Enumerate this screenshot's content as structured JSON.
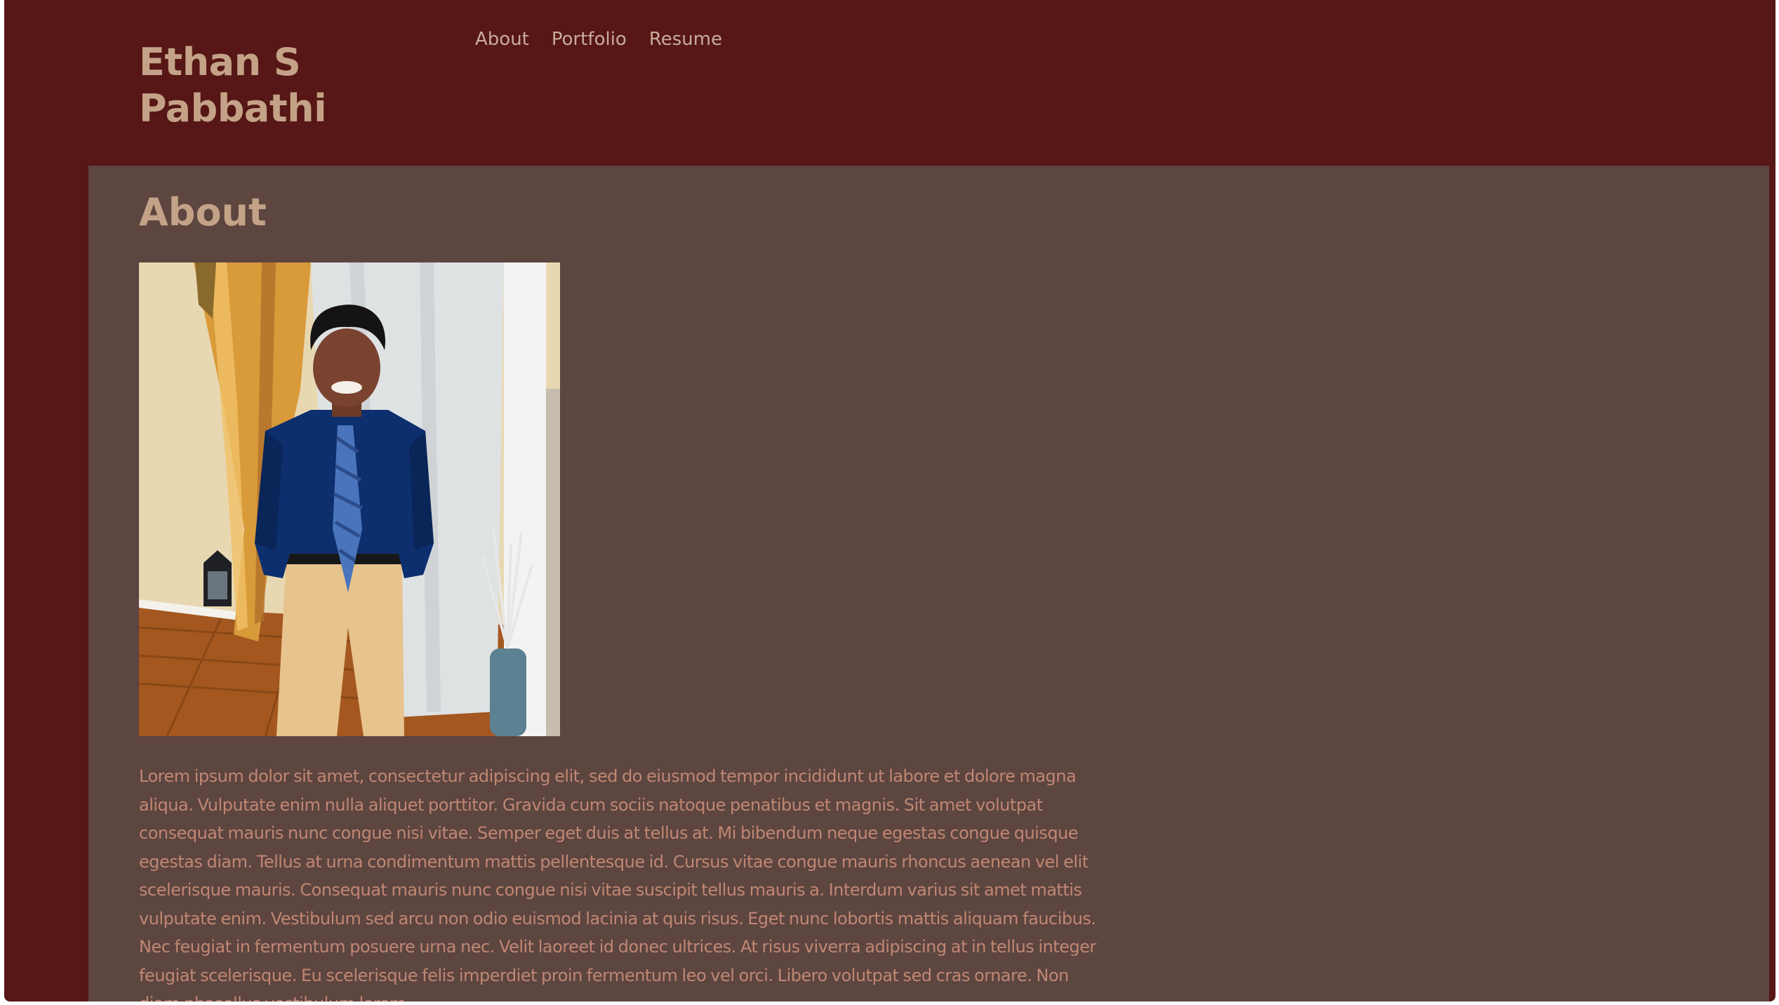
{
  "site": {
    "title_line1": "Ethan S",
    "title_line2": "Pabbathi"
  },
  "nav": {
    "items": [
      "About",
      "Portfolio",
      "Resume"
    ]
  },
  "about": {
    "heading": "About",
    "photo_icon": "portrait-photo",
    "bio": "Lorem ipsum dolor sit amet, consectetur adipiscing elit, sed do eiusmod tempor incididunt ut labore et dolore magna aliqua. Vulputate enim nulla aliquet porttitor. Gravida cum sociis natoque penatibus et magnis. Sit amet volutpat consequat mauris nunc congue nisi vitae. Semper eget duis at tellus at. Mi bibendum neque egestas congue quisque egestas diam. Tellus at urna condimentum mattis pellentesque id. Cursus vitae congue mauris rhoncus aenean vel elit scelerisque mauris. Consequat mauris nunc congue nisi vitae suscipit tellus mauris a. Interdum varius sit amet mattis vulputate enim. Vestibulum sed arcu non odio euismod lacinia at quis risus. Eget nunc lobortis mattis aliquam faucibus. Nec feugiat in fermentum posuere urna nec. Velit laoreet id donec ultrices. At risus viverra adipiscing at in tellus integer feugiat scelerisque. Eu scelerisque felis imperdiet proin fermentum leo vel orci. Libero volutpat sed cras ornare. Non diam phasellus vestibulum lorem"
  },
  "colors": {
    "frame_bg": "#561716",
    "content_bg": "#5d4540",
    "title": "#c4a287",
    "nav_link": "#c9ab98",
    "body_text": "#c08773"
  }
}
